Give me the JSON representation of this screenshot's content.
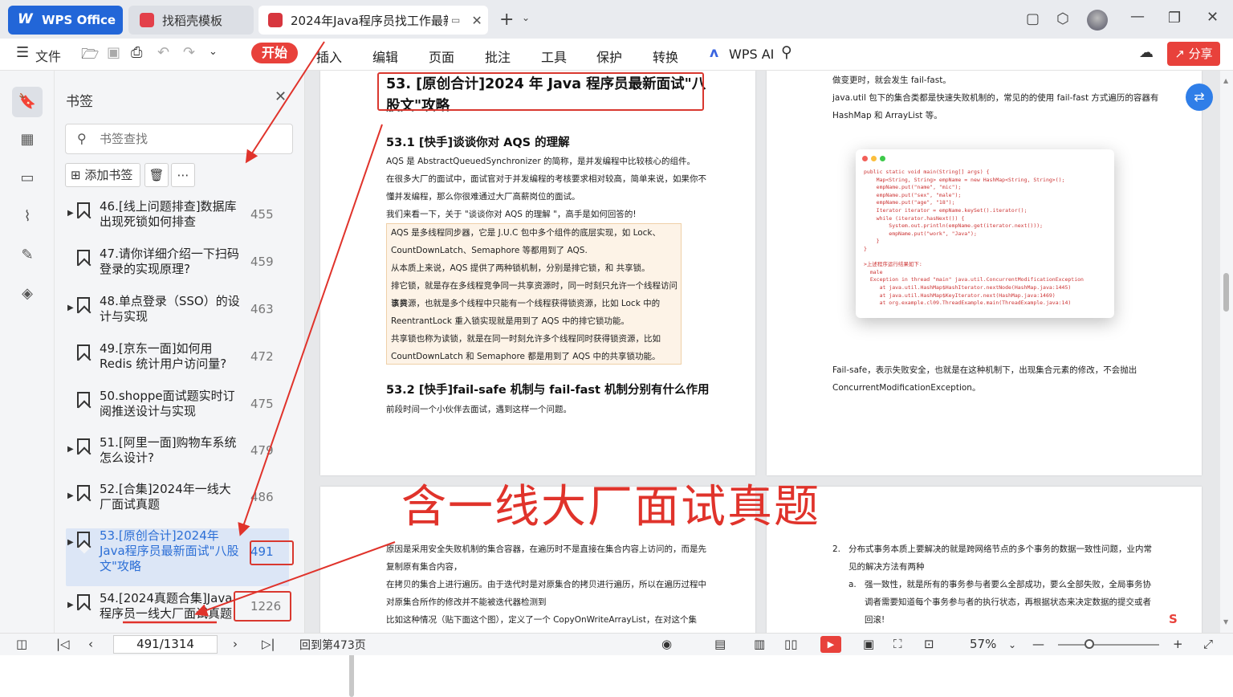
{
  "tabs": {
    "wps": "WPS Office",
    "template": "找稻壳模板",
    "document": "2024年Java程序员找工作最新"
  },
  "toolbar": {
    "file": "文件",
    "ribbon": [
      "开始",
      "插入",
      "编辑",
      "页面",
      "批注",
      "工具",
      "保护",
      "转换"
    ],
    "wps_ai": "WPS AI",
    "share": "分享"
  },
  "bookmarks": {
    "title": "书签",
    "search_placeholder": "书签查找",
    "add": "添加书签",
    "items": [
      {
        "label": "46.[线上问题排查]数据库出现死锁如何排查",
        "page": "455",
        "expandable": true
      },
      {
        "label": "47.请你详细介绍一下扫码登录的实现原理?",
        "page": "459",
        "expandable": false
      },
      {
        "label": "48.单点登录（SSO）的设计与实现",
        "page": "463",
        "expandable": true
      },
      {
        "label": "49.[京东一面]如何用 Redis 统计用户访问量?",
        "page": "472",
        "expandable": false
      },
      {
        "label": "50.shoppe面试题实时订阅推送设计与实现",
        "page": "475",
        "expandable": false
      },
      {
        "label": "51.[阿里一面]购物车系统怎么设计?",
        "page": "479",
        "expandable": true
      },
      {
        "label": "52.[合集]2024年一线大厂面试真题",
        "page": "486",
        "expandable": true
      },
      {
        "label": "53.[原创合计]2024年Java程序员最新面试\"八股文\"攻略",
        "page": "491",
        "expandable": true,
        "selected": true
      },
      {
        "label": "54.[2024真题合集]Java程序员一线大厂面试真题",
        "page": "1226",
        "expandable": true
      }
    ]
  },
  "page1": {
    "h1": "53. [原创合计]2024 年 Java 程序员最新面试\"八股文\"攻略",
    "h2a": "53.1 [快手]谈谈你对 AQS 的理解",
    "p1": "AQS 是 AbstractQueuedSynchronizer 的简称，是并发编程中比较核心的组件。",
    "p2": "在很多大厂的面试中，面试官对于并发编程的考核要求相对较高，简单来说，如果你不",
    "p3": "懂并发编程，那么你很难通过大厂高薪岗位的面试。",
    "p4": "我们来看一下，关于 \"谈谈你对 AQS 的理解 \"，高手是如何回答的!",
    "q1": "AQS 是多线程同步器，它是 J.U.C 包中多个组件的底层实现，如 Lock、",
    "q2": "CountDownLatch、Semaphore 等都用到了 AQS.",
    "q3": "从本质上来说，AQS 提供了两种锁机制，分别是排它锁，和 共享锁。",
    "q4": "排它锁，就是存在多线程竞争同一共享资源时，同一时刻只允许一个线程访问该共",
    "q5": "享资源，也就是多个线程中只能有一个线程获得锁资源，比如 Lock 中的",
    "q6": "ReentrantLock 重入锁实现就是用到了 AQS 中的排它锁功能。",
    "q7": "共享锁也称为读锁，就是在同一时刻允许多个线程同时获得锁资源，比如",
    "q8": "CountDownLatch 和 Semaphore 都是用到了 AQS 中的共享锁功能。",
    "h2b": "53.2 [快手]fail-safe 机制与 fail-fast 机制分别有什么作用",
    "p5": "前段时间一个小伙伴去面试，遇到这样一个问题。"
  },
  "page2": {
    "p1": "做变更时，就会发生 fail-fast。",
    "p2": "java.util 包下的集合类都是快速失败机制的，常见的的使用 fail-fast 方式遍历的容器有",
    "p3": "HashMap 和 ArrayList 等。",
    "code": "public static void main(String[] args) {\n    Map<String, String> empName = new HashMap<String, String>();\n    empName.put(\"name\", \"mic\");\n    empName.put(\"sex\", \"male\");\n    empName.put(\"age\", \"18\");\n    Iterator iterator = empName.keySet().iterator();\n    while (iterator.hasNext()) {\n        System.out.println(empName.get(iterator.next()));\n        empName.put(\"work\", \"Java\");\n    }\n}\n\n>上述程序运行结果如下:\n  male\n  Exception in thread \"main\" java.util.ConcurrentModificationException\n     at java.util.HashMap$HashIterator.nextNode(HashMap.java:1445)\n     at java.util.HashMap$KeyIterator.next(HashMap.java:1469)\n     at org.example.cl09.ThreadExample.main(ThreadExample.java:14)",
    "p4": "Fail-safe，表示失败安全，也就是在这种机制下，出现集合元素的修改，不会抛出",
    "p5": "ConcurrentModificationException。"
  },
  "page3": {
    "p1": "原因是采用安全失败机制的集合容器，在遍历时不是直接在集合内容上访问的，而是先",
    "p2": "复制原有集合内容，",
    "p3": "在拷贝的集合上进行遍历。由于迭代时是对原集合的拷贝进行遍历，所以在遍历过程中",
    "p4": "对原集合所作的修改并不能被迭代器检测到",
    "p5": "比如这种情况（贴下面这个图），定义了一个 CopyOnWriteArrayList，在对这个集"
  },
  "page4": {
    "n2": "2.",
    "p1": "分布式事务本质上要解决的就是跨网络节点的多个事务的数据一致性问题，业内常",
    "p2": "见的解决方法有两种",
    "na": "a.",
    "p3": "强一致性，就是所有的事务参与者要么全部成功，要么全部失败，全局事务协",
    "p4": "调者需要知道每个事务参与者的执行状态，再根据状态来决定数据的提交或者",
    "p5": "回滚!"
  },
  "overlay": {
    "big_text": "含一线大厂面试真题",
    "accent": "#e0332b"
  },
  "status": {
    "page": "491/1314",
    "goto": "回到第473页",
    "zoom": "57%"
  }
}
